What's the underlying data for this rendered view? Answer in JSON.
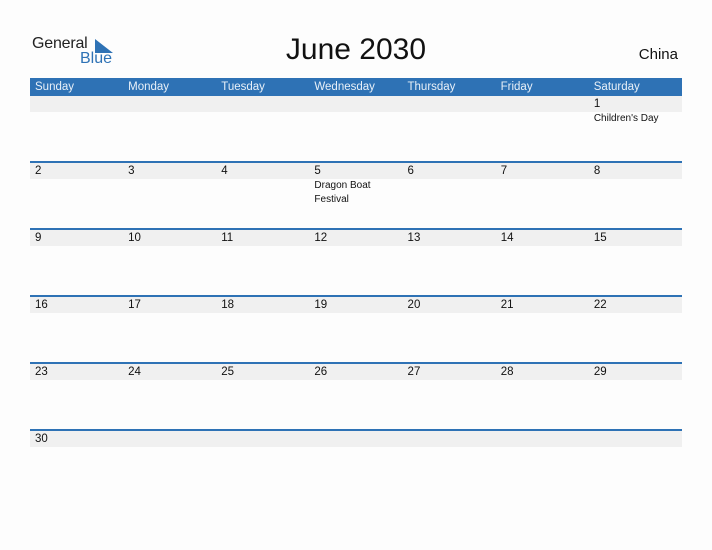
{
  "logo": {
    "word1": "General",
    "word2": "Blue"
  },
  "title": "June 2030",
  "country": "China",
  "colors": {
    "accent": "#2e72b5",
    "band": "#f0f0f0"
  },
  "weekdays": [
    "Sunday",
    "Monday",
    "Tuesday",
    "Wednesday",
    "Thursday",
    "Friday",
    "Saturday"
  ],
  "weeks": [
    [
      {
        "d": ""
      },
      {
        "d": ""
      },
      {
        "d": ""
      },
      {
        "d": ""
      },
      {
        "d": ""
      },
      {
        "d": ""
      },
      {
        "d": "1",
        "ev": "Children's Day"
      }
    ],
    [
      {
        "d": "2"
      },
      {
        "d": "3"
      },
      {
        "d": "4"
      },
      {
        "d": "5",
        "ev": "Dragon Boat Festival"
      },
      {
        "d": "6"
      },
      {
        "d": "7"
      },
      {
        "d": "8"
      }
    ],
    [
      {
        "d": "9"
      },
      {
        "d": "10"
      },
      {
        "d": "11"
      },
      {
        "d": "12"
      },
      {
        "d": "13"
      },
      {
        "d": "14"
      },
      {
        "d": "15"
      }
    ],
    [
      {
        "d": "16"
      },
      {
        "d": "17"
      },
      {
        "d": "18"
      },
      {
        "d": "19"
      },
      {
        "d": "20"
      },
      {
        "d": "21"
      },
      {
        "d": "22"
      }
    ],
    [
      {
        "d": "23"
      },
      {
        "d": "24"
      },
      {
        "d": "25"
      },
      {
        "d": "26"
      },
      {
        "d": "27"
      },
      {
        "d": "28"
      },
      {
        "d": "29"
      }
    ],
    [
      {
        "d": "30"
      },
      {
        "d": ""
      },
      {
        "d": ""
      },
      {
        "d": ""
      },
      {
        "d": ""
      },
      {
        "d": ""
      },
      {
        "d": ""
      }
    ]
  ]
}
